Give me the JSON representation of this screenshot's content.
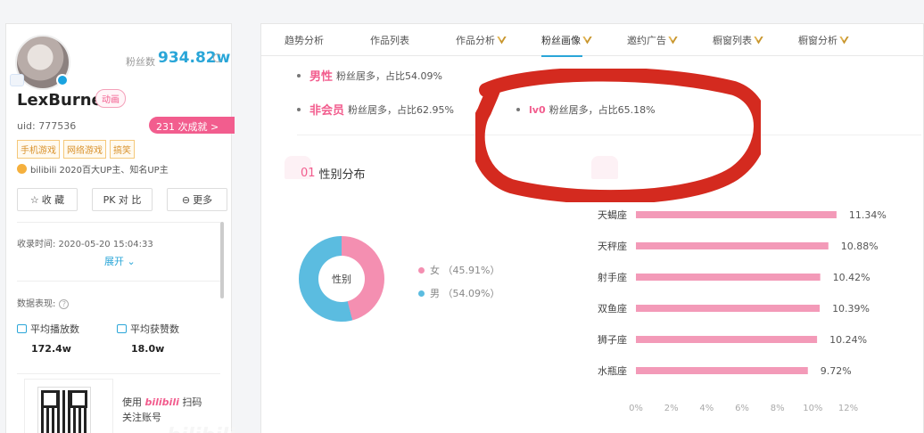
{
  "profile": {
    "fans_label": "粉丝数",
    "fans_value": "934.82w",
    "username": "LexBurner",
    "category": "动画",
    "uid": "uid: 777536",
    "achievement": "231 次成就 >",
    "tags": [
      "手机游戏",
      "网络游戏",
      "搞笑"
    ],
    "award": "bilibili 2020百大UP主、知名UP主",
    "actions": [
      {
        "icon": "star-icon",
        "label": "收 藏"
      },
      {
        "icon": "pk-icon",
        "label": "PK 对 比"
      },
      {
        "icon": "more-icon",
        "label": "更多"
      }
    ],
    "record_time": "收录时间:  2020-05-20 15:04:33",
    "expand_label": "展开",
    "performance_label": "数据表现:",
    "metrics": [
      {
        "label": "平均播放数",
        "value": "172.4w",
        "icon": "play-icon"
      },
      {
        "label": "平均获赞数",
        "value": "18.0w",
        "icon": "thumb-icon"
      }
    ],
    "scan": {
      "prefix": "使用",
      "brand": "bilibili",
      "suffix": "扫码",
      "line2": "关注账号"
    },
    "watermark": "bilibili"
  },
  "tabs": [
    {
      "label": "趋势分析",
      "vip": false
    },
    {
      "label": "作品列表",
      "vip": false
    },
    {
      "label": "作品分析",
      "vip": true
    },
    {
      "label": "粉丝画像",
      "vip": true,
      "active": true
    },
    {
      "label": "邀约广告",
      "vip": true
    },
    {
      "label": "橱窗列表",
      "vip": true
    },
    {
      "label": "橱窗分析",
      "vip": true
    }
  ],
  "summary": [
    {
      "key": "男性",
      "text": "粉丝居多，占比54.09%"
    },
    {
      "key": "非会员",
      "text": "粉丝居多，占比62.95%"
    },
    {
      "key": "lv0",
      "text": "粉丝居多，占比65.18%"
    }
  ],
  "gender_section": {
    "num": "01",
    "title": "性别分布",
    "center_label": "性别"
  },
  "colors": {
    "accent": "#2aa6d8",
    "pink": "#f25d8e",
    "female": "#f48fb1",
    "male": "#5bbce0",
    "bar": "#f39ab8",
    "annotation": "#d42a1f"
  },
  "chart_data": [
    {
      "type": "pie",
      "categories": [
        "女",
        "男"
      ],
      "values": [
        45.91,
        54.09
      ],
      "legend_labels": [
        "女 （45.91%）",
        "男 （54.09%）"
      ]
    },
    {
      "type": "bar",
      "orientation": "horizontal",
      "categories": [
        "天蝎座",
        "天秤座",
        "射手座",
        "双鱼座",
        "狮子座",
        "水瓶座"
      ],
      "values": [
        11.34,
        10.88,
        10.42,
        10.39,
        10.24,
        9.72
      ],
      "value_labels": [
        "11.34%",
        "10.88%",
        "10.42%",
        "10.39%",
        "10.24%",
        "9.72%"
      ],
      "xlim": [
        0,
        12
      ],
      "xticks": [
        "0%",
        "2%",
        "4%",
        "6%",
        "8%",
        "10%",
        "12%"
      ]
    }
  ]
}
